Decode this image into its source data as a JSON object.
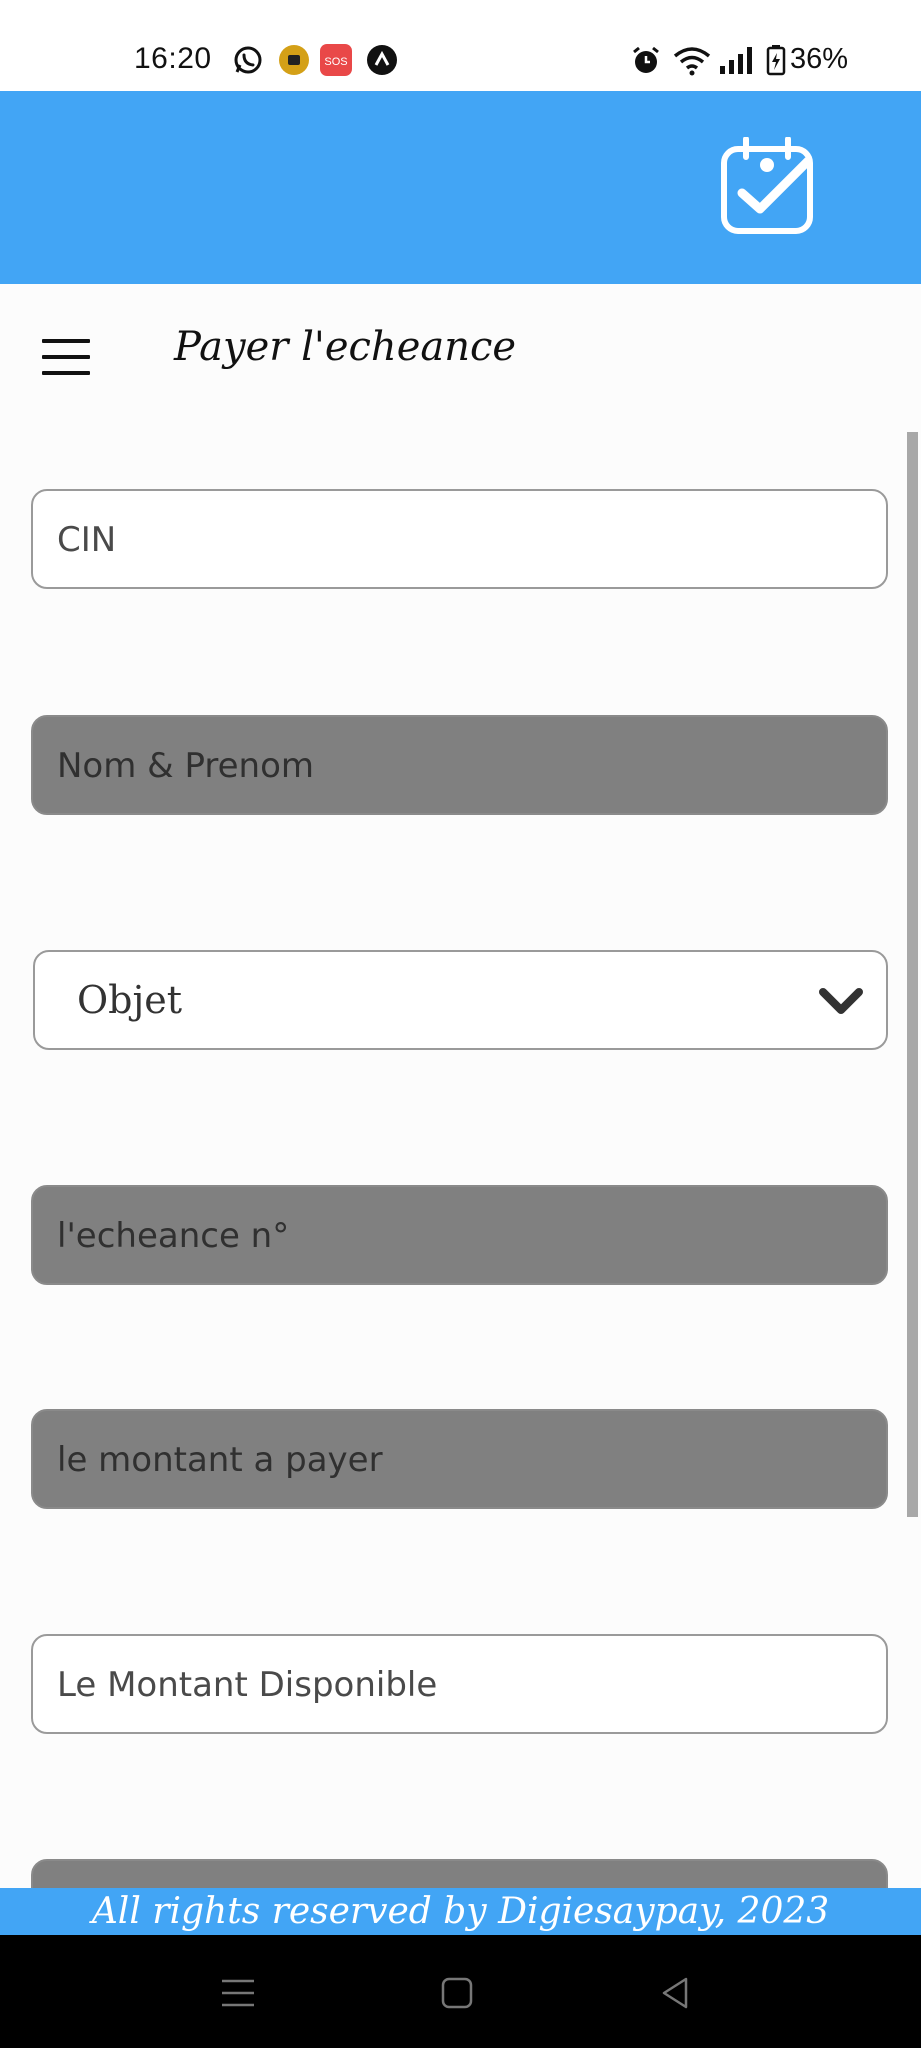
{
  "status_bar": {
    "time": "16:20",
    "battery": "36%",
    "icons": [
      "whatsapp-icon",
      "notification-badge-icon",
      "sos-icon",
      "app-icon",
      "alarm-icon",
      "wifi-icon",
      "signal-icon",
      "battery-icon"
    ]
  },
  "header": {
    "icon": "calendar-check-icon",
    "accent_color": "#42a5f5"
  },
  "page": {
    "title": "Payer l'echeance"
  },
  "form": {
    "cin": {
      "placeholder": "CIN"
    },
    "nom_prenom": {
      "placeholder": "Nom & Prenom"
    },
    "objet": {
      "selected": "Objet"
    },
    "echeance": {
      "placeholder": "l'echeance n°"
    },
    "montant_a_payer": {
      "placeholder": "le montant a payer"
    },
    "montant_disponible": {
      "placeholder": "Le Montant Disponible"
    }
  },
  "footer": {
    "text": "All rights reserved by Digiesaypay, 2023"
  },
  "nav_bar": {
    "icons": [
      "recents-icon",
      "home-icon",
      "back-icon"
    ]
  }
}
